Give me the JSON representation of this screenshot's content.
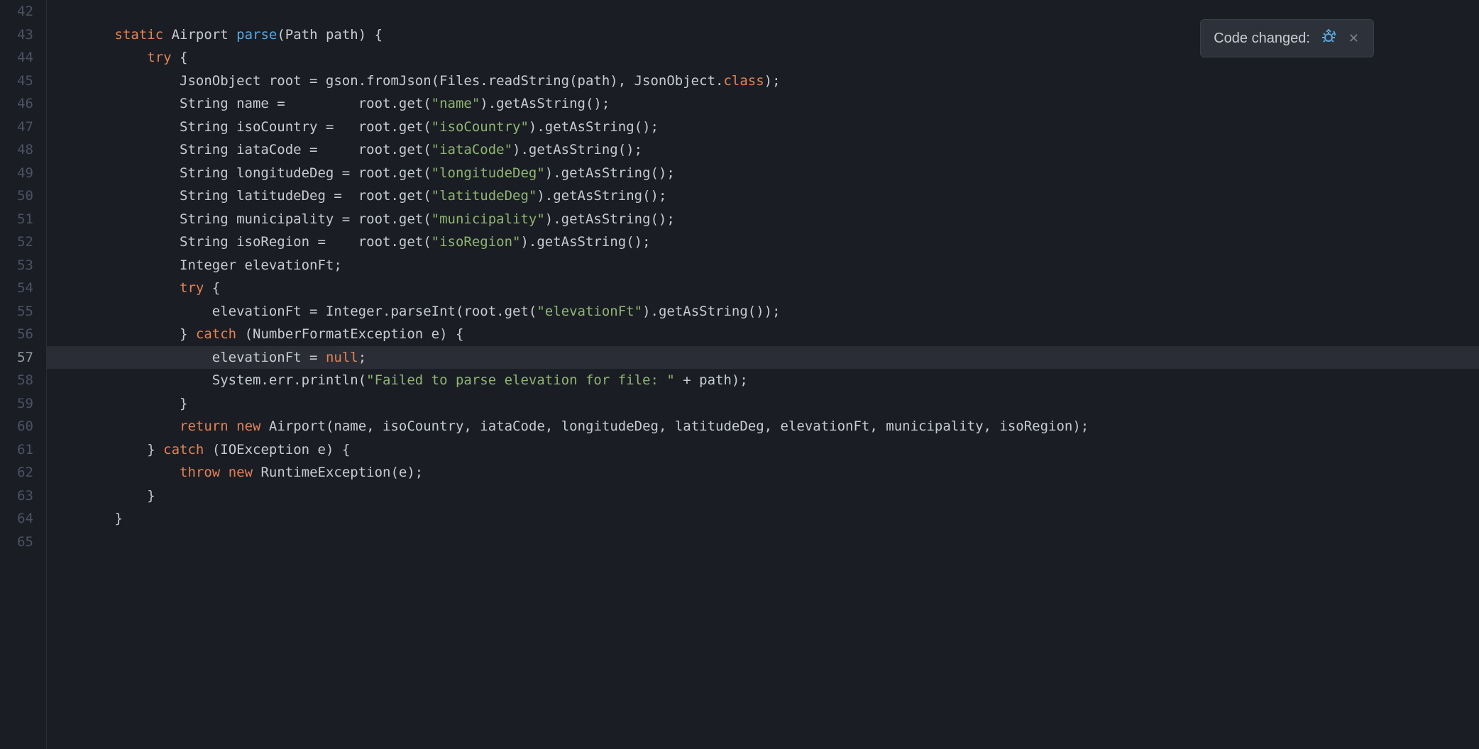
{
  "notification": {
    "label": "Code changed:"
  },
  "editor": {
    "line_numbers": [
      42,
      43,
      44,
      45,
      46,
      47,
      48,
      49,
      50,
      51,
      52,
      53,
      54,
      55,
      56,
      57,
      58,
      59,
      60,
      61,
      62,
      63,
      64,
      65
    ],
    "highlighted_line": 57,
    "code": {
      "l43": {
        "pre": "        ",
        "kw1": "static",
        "sp1": " ",
        "t1": "Airport ",
        "fn": "parse",
        "t2": "(Path path) {"
      },
      "l44": {
        "pre": "            ",
        "kw": "try",
        "t": " {"
      },
      "l45": {
        "pre": "                ",
        "t1": "JsonObject root = gson.fromJson(Files.readString(path), JsonObject.",
        "cls": "class",
        "t2": ");"
      },
      "l46": {
        "pre": "                ",
        "t1": "String name =         root.get(",
        "s": "\"name\"",
        "t2": ").getAsString();"
      },
      "l47": {
        "pre": "                ",
        "t1": "String isoCountry =   root.get(",
        "s": "\"isoCountry\"",
        "t2": ").getAsString();"
      },
      "l48": {
        "pre": "                ",
        "t1": "String iataCode =     root.get(",
        "s": "\"iataCode\"",
        "t2": ").getAsString();"
      },
      "l49": {
        "pre": "                ",
        "t1": "String longitudeDeg = root.get(",
        "s": "\"longitudeDeg\"",
        "t2": ").getAsString();"
      },
      "l50": {
        "pre": "                ",
        "t1": "String latitudeDeg =  root.get(",
        "s": "\"latitudeDeg\"",
        "t2": ").getAsString();"
      },
      "l51": {
        "pre": "                ",
        "t1": "String municipality = root.get(",
        "s": "\"municipality\"",
        "t2": ").getAsString();"
      },
      "l52": {
        "pre": "                ",
        "t1": "String isoRegion =    root.get(",
        "s": "\"isoRegion\"",
        "t2": ").getAsString();"
      },
      "l53": {
        "pre": "                ",
        "t": "Integer elevationFt;"
      },
      "l54": {
        "pre": "                ",
        "kw": "try",
        "t": " {"
      },
      "l55": {
        "pre": "                    ",
        "t1": "elevationFt = Integer.parseInt(root.get(",
        "s": "\"elevationFt\"",
        "t2": ").getAsString());"
      },
      "l56": {
        "pre": "                ",
        "t1": "} ",
        "kw": "catch",
        "t2": " (NumberFormatException e) {"
      },
      "l57": {
        "pre": "                    ",
        "t1": "elevationFt = ",
        "kw": "null",
        "t2": ";"
      },
      "l58": {
        "pre": "                    ",
        "t1": "System.err.println(",
        "s": "\"Failed to parse elevation for file: \"",
        "t2": " + path);"
      },
      "l59": {
        "pre": "                ",
        "t": "}"
      },
      "l60": {
        "pre": "                ",
        "kw1": "return",
        "sp": " ",
        "kw2": "new",
        "t": " Airport(name, isoCountry, iataCode, longitudeDeg, latitudeDeg, elevationFt, municipality, isoRegion);"
      },
      "l61": {
        "pre": "            ",
        "t1": "} ",
        "kw": "catch",
        "t2": " (IOException e) {"
      },
      "l62": {
        "pre": "                ",
        "kw1": "throw",
        "sp": " ",
        "kw2": "new",
        "t": " RuntimeException(e);"
      },
      "l63": {
        "pre": "            ",
        "t": "}"
      },
      "l64": {
        "pre": "        ",
        "t": "}"
      }
    }
  }
}
